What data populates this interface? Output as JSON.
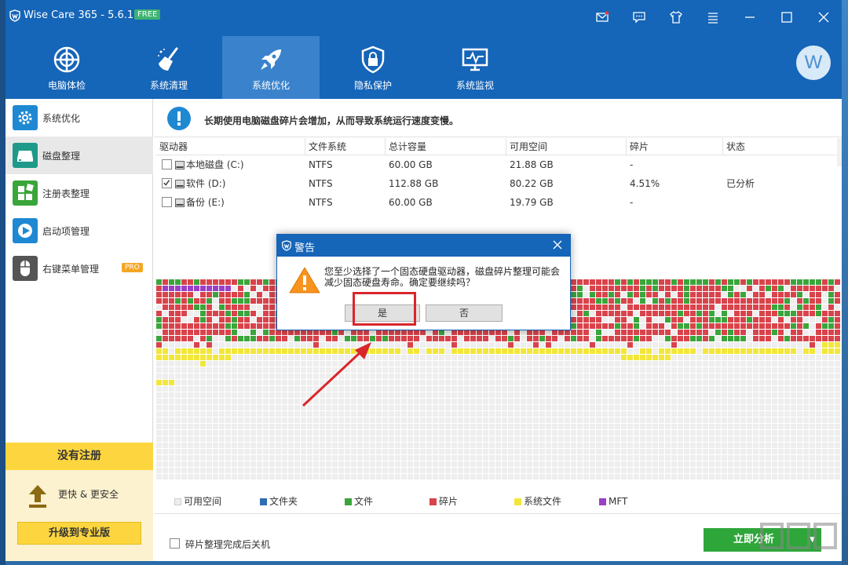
{
  "app": {
    "title": "Wise Care 365 - 5.6.1",
    "badge": "FREE"
  },
  "titlebar_icons": [
    "mail-icon",
    "feedback-icon",
    "skin-icon",
    "menu-icon",
    "minimize-icon",
    "maximize-icon",
    "close-icon"
  ],
  "tabs": [
    {
      "label": "电脑体检",
      "icon": "checkup-icon"
    },
    {
      "label": "系统清理",
      "icon": "broom-icon"
    },
    {
      "label": "系统优化",
      "icon": "rocket-icon",
      "active": true
    },
    {
      "label": "隐私保护",
      "icon": "lock-shield-icon"
    },
    {
      "label": "系统监视",
      "icon": "monitor-icon"
    }
  ],
  "avatar_letter": "W",
  "sidebar": {
    "items": [
      {
        "label": "系统优化",
        "icon": "gear-icon",
        "color": "#1e88d2"
      },
      {
        "label": "磁盘整理",
        "icon": "disk-icon",
        "color": "#1f9a8a",
        "active": true
      },
      {
        "label": "注册表整理",
        "icon": "registry-icon",
        "color": "#3aa53a"
      },
      {
        "label": "启动项管理",
        "icon": "play-icon",
        "color": "#1e88d2"
      },
      {
        "label": "右键菜单管理",
        "icon": "mouse-icon",
        "color": "#555555",
        "badge": "PRO"
      }
    ],
    "register": {
      "title": "没有注册",
      "slogan": "更快 & 更安全",
      "button": "升级到专业版"
    }
  },
  "info": {
    "text": "长期使用电脑磁盘碎片会增加，从而导致系统运行速度变慢。"
  },
  "table": {
    "headers": [
      "驱动器",
      "文件系统",
      "总计容量",
      "可用空间",
      "碎片",
      "状态"
    ],
    "rows": [
      {
        "checked": false,
        "drive": "本地磁盘 (C:)",
        "fs": "NTFS",
        "total": "60.00 GB",
        "free": "21.88 GB",
        "frag": "-",
        "status": ""
      },
      {
        "checked": true,
        "drive": "软件 (D:)",
        "fs": "NTFS",
        "total": "112.88 GB",
        "free": "80.22 GB",
        "frag": "4.51%",
        "status": "已分析"
      },
      {
        "checked": false,
        "drive": "备份 (E:)",
        "fs": "NTFS",
        "total": "60.00 GB",
        "free": "19.79 GB",
        "frag": "-",
        "status": ""
      }
    ]
  },
  "legend": [
    {
      "label": "可用空间",
      "color": "#eeeeee"
    },
    {
      "label": "文件夹",
      "color": "#2f6db5"
    },
    {
      "label": "文件",
      "color": "#3aa53a"
    },
    {
      "label": "碎片",
      "color": "#d9434b"
    },
    {
      "label": "系统文件",
      "color": "#f2e63a"
    },
    {
      "label": "MFT",
      "color": "#9b3fc6"
    }
  ],
  "bottom": {
    "shutdown_label": "碎片整理完成后关机",
    "analyze_button": "立即分析"
  },
  "dialog": {
    "title": "警告",
    "message": "您至少选择了一个固态硬盘驱动器，磁盘碎片整理可能会减少固态硬盘寿命。确定要继续吗？",
    "yes": "是",
    "no": "否"
  }
}
